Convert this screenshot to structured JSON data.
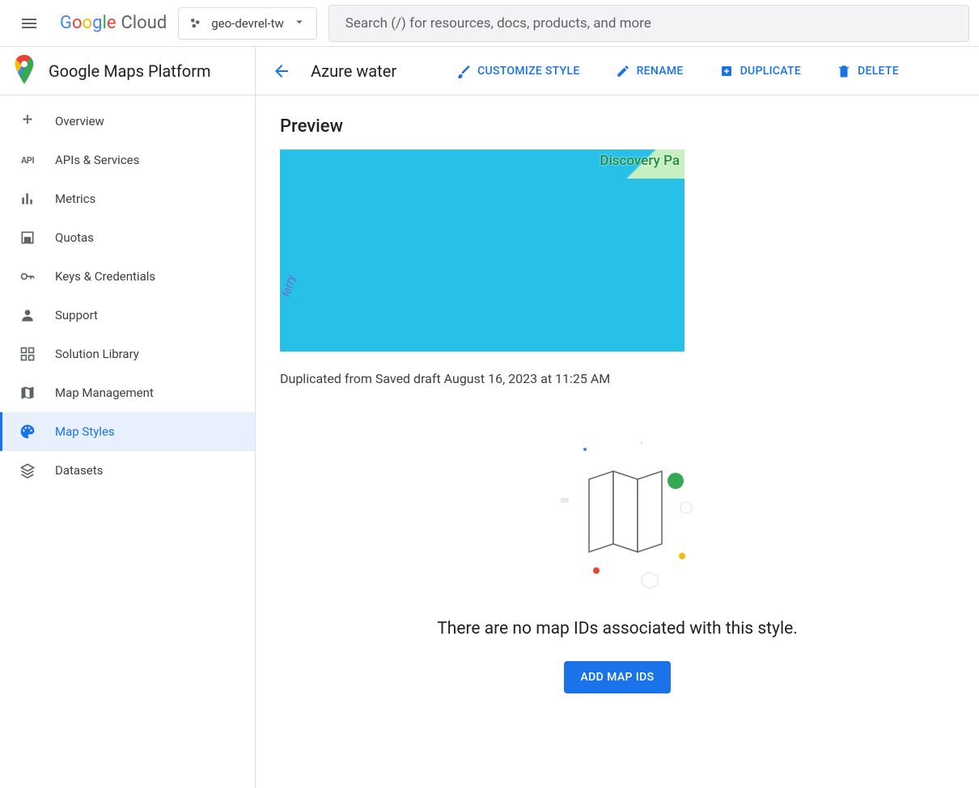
{
  "topbar": {
    "logo_text": "Google",
    "logo_suffix": "Cloud",
    "project_name": "geo-devrel-tw",
    "search_placeholder": "Search (/) for resources, docs, products, and more"
  },
  "sidebar": {
    "product_title": "Google Maps Platform",
    "items": [
      {
        "label": "Overview",
        "icon": "move-icon"
      },
      {
        "label": "APIs & Services",
        "icon": "api-icon"
      },
      {
        "label": "Metrics",
        "icon": "bar-chart-icon"
      },
      {
        "label": "Quotas",
        "icon": "quota-icon"
      },
      {
        "label": "Keys & Credentials",
        "icon": "key-icon"
      },
      {
        "label": "Support",
        "icon": "person-icon"
      },
      {
        "label": "Solution Library",
        "icon": "widgets-icon"
      },
      {
        "label": "Map Management",
        "icon": "map-icon"
      },
      {
        "label": "Map Styles",
        "icon": "palette-icon",
        "active": true
      },
      {
        "label": "Datasets",
        "icon": "layers-icon"
      }
    ]
  },
  "detail": {
    "title": "Azure water",
    "actions": {
      "customize": "CUSTOMIZE STYLE",
      "rename": "RENAME",
      "duplicate": "DUPLICATE",
      "delete": "DELETE"
    },
    "preview_heading": "Preview",
    "map_park_label": "Discovery Pa",
    "map_ferry_label": "ferry",
    "preview_caption": "Duplicated from Saved draft August 16, 2023 at 11:25 AM",
    "empty_text": "There are no map IDs associated with this style.",
    "add_map_ids": "ADD MAP IDS"
  }
}
